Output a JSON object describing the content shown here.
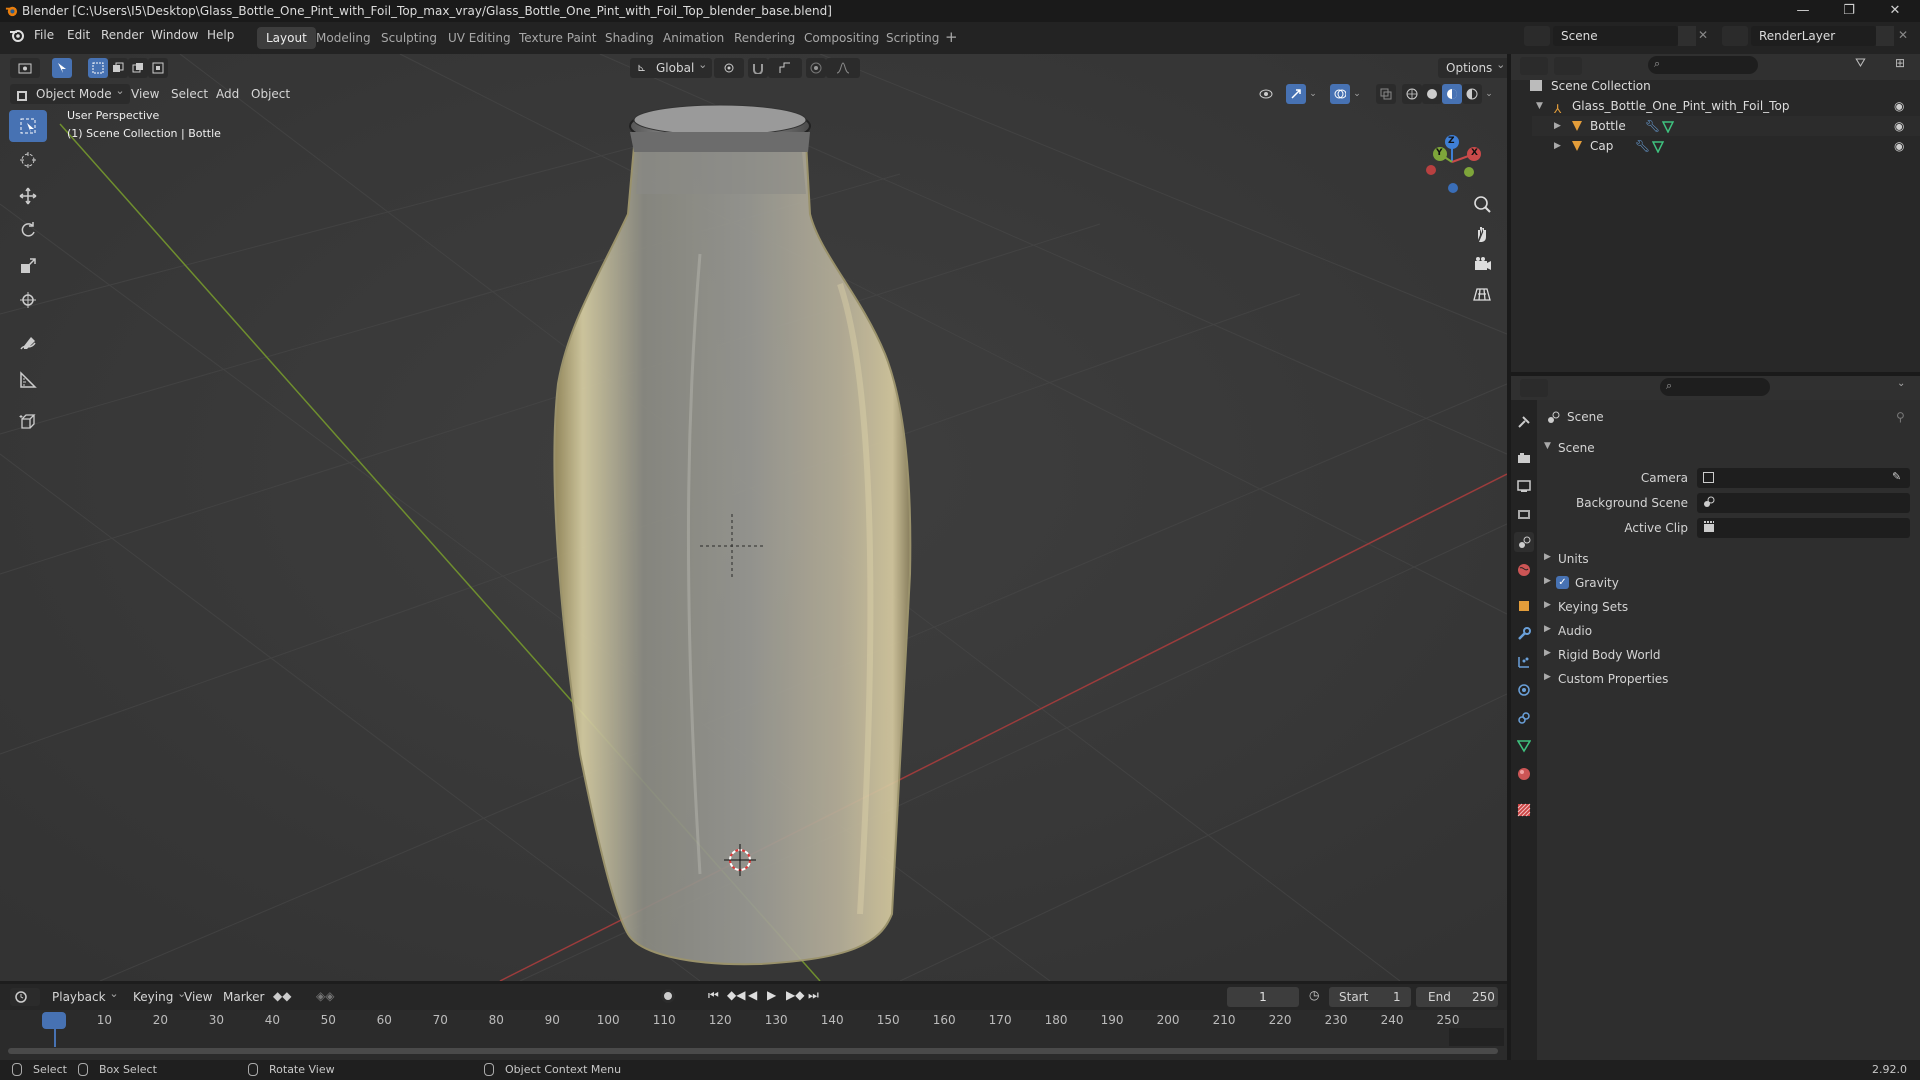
{
  "window": {
    "title": "Blender [C:\\Users\\I5\\Desktop\\Glass_Bottle_One_Pint_with_Foil_Top_max_vray/Glass_Bottle_One_Pint_with_Foil_Top_blender_base.blend]"
  },
  "menu": {
    "items": [
      "File",
      "Edit",
      "Render",
      "Window",
      "Help"
    ]
  },
  "workspaces": [
    "Layout",
    "Modeling",
    "Sculpting",
    "UV Editing",
    "Texture Paint",
    "Shading",
    "Animation",
    "Rendering",
    "Compositing",
    "Scripting"
  ],
  "active_workspace": "Layout",
  "topright": {
    "scene": "Scene",
    "view_layer": "RenderLayer"
  },
  "viewport": {
    "transform_orientation": "Global",
    "options_label": "Options",
    "mode": "Object Mode",
    "header_menus": [
      "View",
      "Select",
      "Add",
      "Object"
    ],
    "overlay_line1": "User Perspective",
    "overlay_line2": "(1) Scene Collection | Bottle",
    "gizmo": {
      "x": "X",
      "y": "Y",
      "z": "Z"
    }
  },
  "outliner": {
    "root": "Scene Collection",
    "collection": "Glass_Bottle_One_Pint_with_Foil_Top",
    "objects": [
      "Bottle",
      "Cap"
    ]
  },
  "properties": {
    "context": "Scene",
    "panel": "Scene",
    "fields": [
      {
        "label": "Camera"
      },
      {
        "label": "Background Scene"
      },
      {
        "label": "Active Clip"
      }
    ],
    "subpanels": [
      "Units",
      "Gravity",
      "Keying Sets",
      "Audio",
      "Rigid Body World",
      "Custom Properties"
    ],
    "gravity_checked": true
  },
  "timeline": {
    "menus": [
      "Playback",
      "Keying",
      "View",
      "Marker"
    ],
    "current_frame": "1",
    "start_label": "Start",
    "start": "1",
    "end_label": "End",
    "end": "250",
    "ticks": [
      "1",
      "10",
      "20",
      "30",
      "40",
      "50",
      "60",
      "70",
      "80",
      "90",
      "100",
      "110",
      "120",
      "130",
      "140",
      "150",
      "160",
      "170",
      "180",
      "190",
      "200",
      "210",
      "220",
      "230",
      "240",
      "250"
    ]
  },
  "status": {
    "select": "Select",
    "box_select": "Box Select",
    "rotate_view": "Rotate View",
    "context_menu": "Object Context Menu",
    "version": "2.92.0"
  },
  "colors": {
    "accent": "#4772b3",
    "x_axis": "#c94a4a",
    "y_axis": "#7ea53a",
    "z_axis": "#3f7fd6",
    "orange": "#e39d3a"
  }
}
